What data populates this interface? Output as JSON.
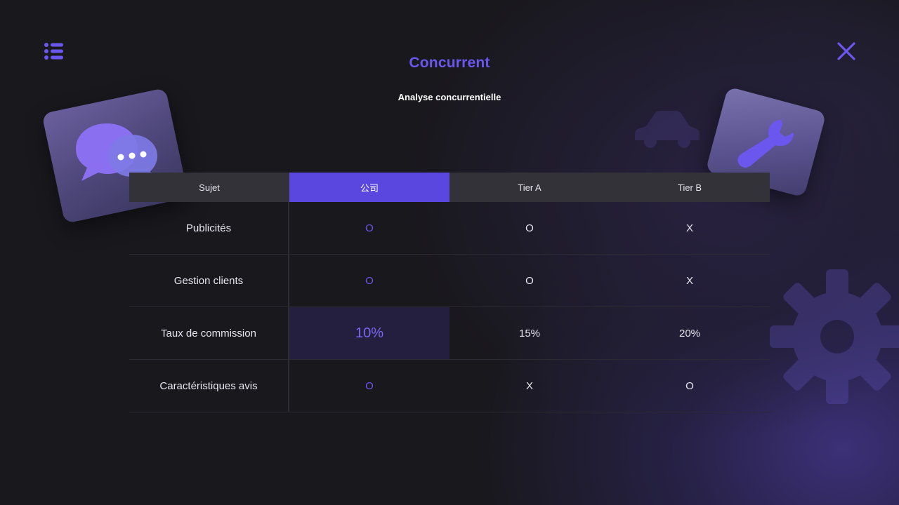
{
  "header": {
    "title": "Concurrent",
    "subtitle": "Analyse concurrentielle"
  },
  "icons": {
    "menu": "list-menu-icon",
    "close": "close-icon",
    "chat": "chat-bubbles-icon",
    "wrench": "wrench-icon",
    "gear": "gear-icon",
    "car": "car-icon"
  },
  "colors": {
    "accent": "#6b57ee",
    "header_highlight": "#5a47e0",
    "background": "#19181d"
  },
  "table": {
    "columns": [
      "Sujet",
      "公司",
      "Tier A",
      "Tier B"
    ],
    "rows": [
      {
        "subject": "Publicités",
        "company": "O",
        "tier_a": "O",
        "tier_b": "X"
      },
      {
        "subject": "Gestion clients",
        "company": "O",
        "tier_a": "O",
        "tier_b": "X"
      },
      {
        "subject": "Taux de commission",
        "company": "10%",
        "tier_a": "15%",
        "tier_b": "20%"
      },
      {
        "subject": "Caractéristiques avis",
        "company": "O",
        "tier_a": "X",
        "tier_b": "O"
      }
    ]
  }
}
